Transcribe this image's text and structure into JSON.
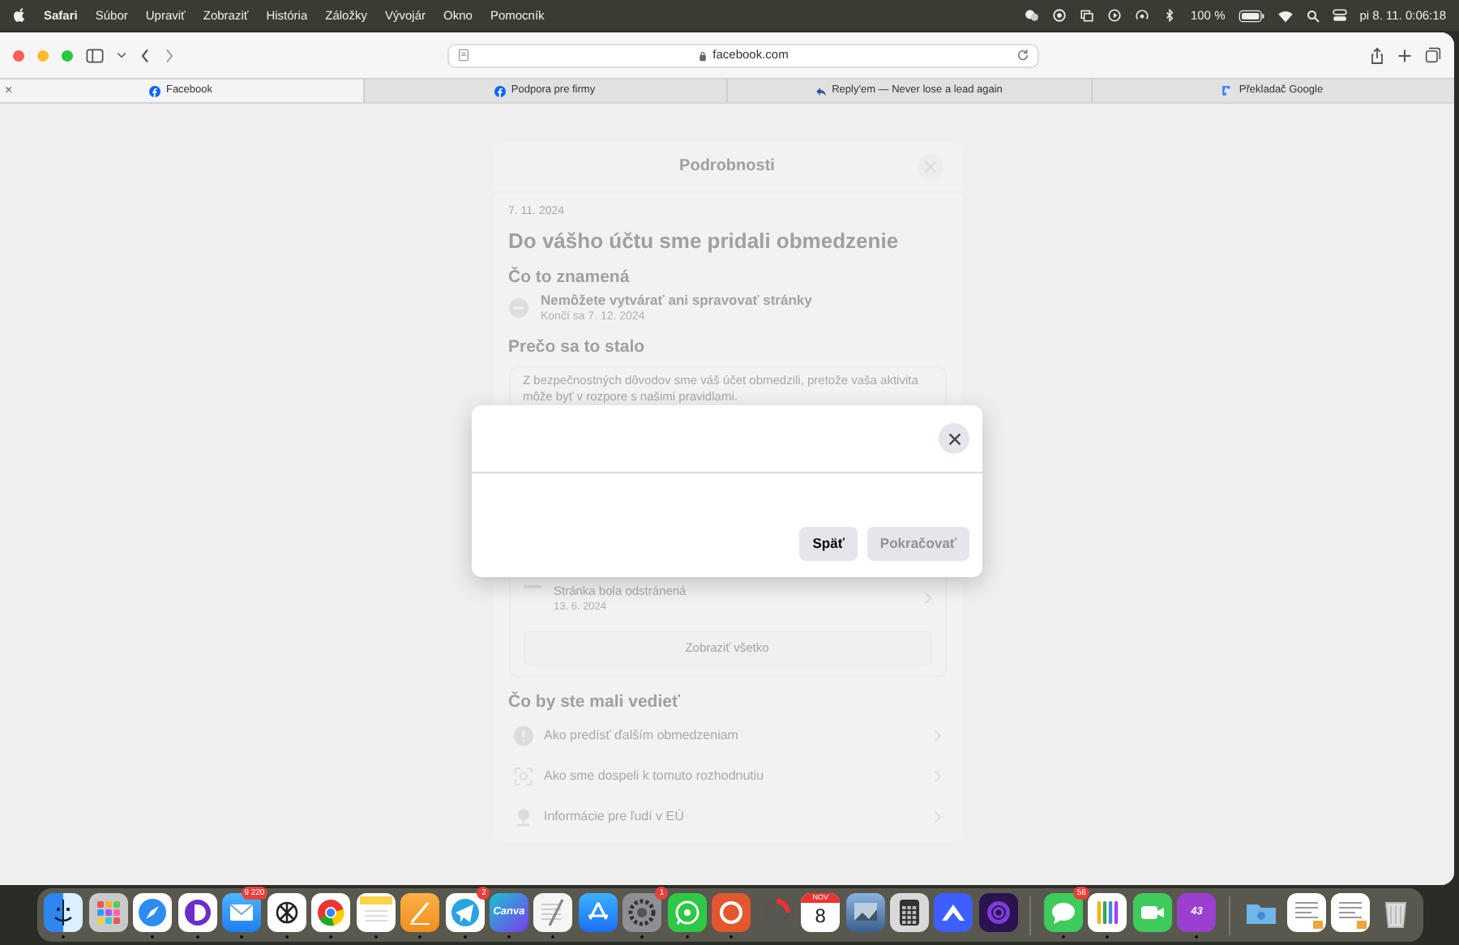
{
  "menu_bar": {
    "app_name": "Safari",
    "menus": [
      "Súbor",
      "Upraviť",
      "Zobraziť",
      "História",
      "Záložky",
      "Vývojár",
      "Okno",
      "Pomocník"
    ],
    "battery": "100 %",
    "clock": "pi 8. 11.  0:06:18"
  },
  "browser": {
    "address": "facebook.com",
    "tabs": [
      {
        "label": "Facebook",
        "kind": "facebook",
        "selected": true,
        "close": "×"
      },
      {
        "label": "Podpora pre firmy",
        "kind": "facebook",
        "selected": false
      },
      {
        "label": "Reply'em — Never lose a lead again",
        "kind": "reply",
        "selected": false
      },
      {
        "label": "Překladač Google",
        "kind": "translate",
        "selected": false
      }
    ]
  },
  "background_page": {
    "title": "Podrobnosti",
    "date": "7. 11. 2024",
    "heading": "Do vášho účtu sme pridali obmedzenie",
    "meaning_heading": "Čo to znamená",
    "restriction": {
      "title": "Nemôžete vytvárať ani spravovať stránky",
      "ends": "Končí sa 7. 12. 2024"
    },
    "reason_heading": "Prečo sa to stalo",
    "reason": "Z bezpečnostných dôvodov sme váš účet obmedzili, pretože vaša aktivita môže byť v rozpore s našimi pravidlami.",
    "activity": {
      "title": "Stránka bola odstránená",
      "date": "13. 6. 2024"
    },
    "show_all": "Zobraziť všetko",
    "know_heading": "Čo by ste mali vedieť",
    "links": [
      {
        "kind": "alert",
        "label": "Ako predísť ďalším obmedzeniam"
      },
      {
        "kind": "scan",
        "label": "Ako sme dospeli k tomuto rozhodnutiu"
      },
      {
        "kind": "pin",
        "label": "Informácie pre ľudí v EÚ"
      }
    ]
  },
  "dialog": {
    "buttons": [
      {
        "label": "Späť",
        "disabled": false
      },
      {
        "label": "Pokračovať",
        "disabled": true
      }
    ]
  },
  "dock": {
    "items": [
      {
        "kind": "finder",
        "running": true
      },
      {
        "kind": "launchpad",
        "running": false
      },
      {
        "kind": "safari",
        "running": true
      },
      {
        "kind": "dapp",
        "running": true
      },
      {
        "kind": "mail",
        "running": true,
        "badge": "9 220"
      },
      {
        "kind": "chatgpt",
        "running": true
      },
      {
        "kind": "chrome",
        "running": true
      },
      {
        "kind": "notes",
        "running": true
      },
      {
        "kind": "pages",
        "running": true
      },
      {
        "kind": "telegram",
        "running": true,
        "badge": "2"
      },
      {
        "kind": "canva",
        "running": true,
        "label": "Canva"
      },
      {
        "kind": "textedit",
        "running": true
      },
      {
        "kind": "appstore",
        "running": false
      },
      {
        "kind": "settings",
        "running": true,
        "badge": "1"
      },
      {
        "kind": "whatsapp",
        "running": true
      },
      {
        "kind": "duckduckgo",
        "running": true
      },
      {
        "kind": "ring",
        "running": false
      },
      {
        "kind": "calendar",
        "running": false,
        "month": "NOV",
        "day": "8"
      },
      {
        "kind": "preview",
        "running": false
      },
      {
        "kind": "calculator",
        "running": false
      },
      {
        "kind": "vpn",
        "running": false
      },
      {
        "kind": "tor",
        "running": false
      },
      {
        "kind": "separator"
      },
      {
        "kind": "messages",
        "running": true,
        "badge": "56"
      },
      {
        "kind": "passwords",
        "running": true
      },
      {
        "kind": "facetime",
        "running": false
      },
      {
        "kind": "counter",
        "running": true,
        "label": "43"
      },
      {
        "kind": "separator"
      },
      {
        "kind": "folder",
        "running": false
      },
      {
        "kind": "document",
        "running": false
      },
      {
        "kind": "document",
        "running": false
      },
      {
        "kind": "trash",
        "running": false
      }
    ]
  }
}
